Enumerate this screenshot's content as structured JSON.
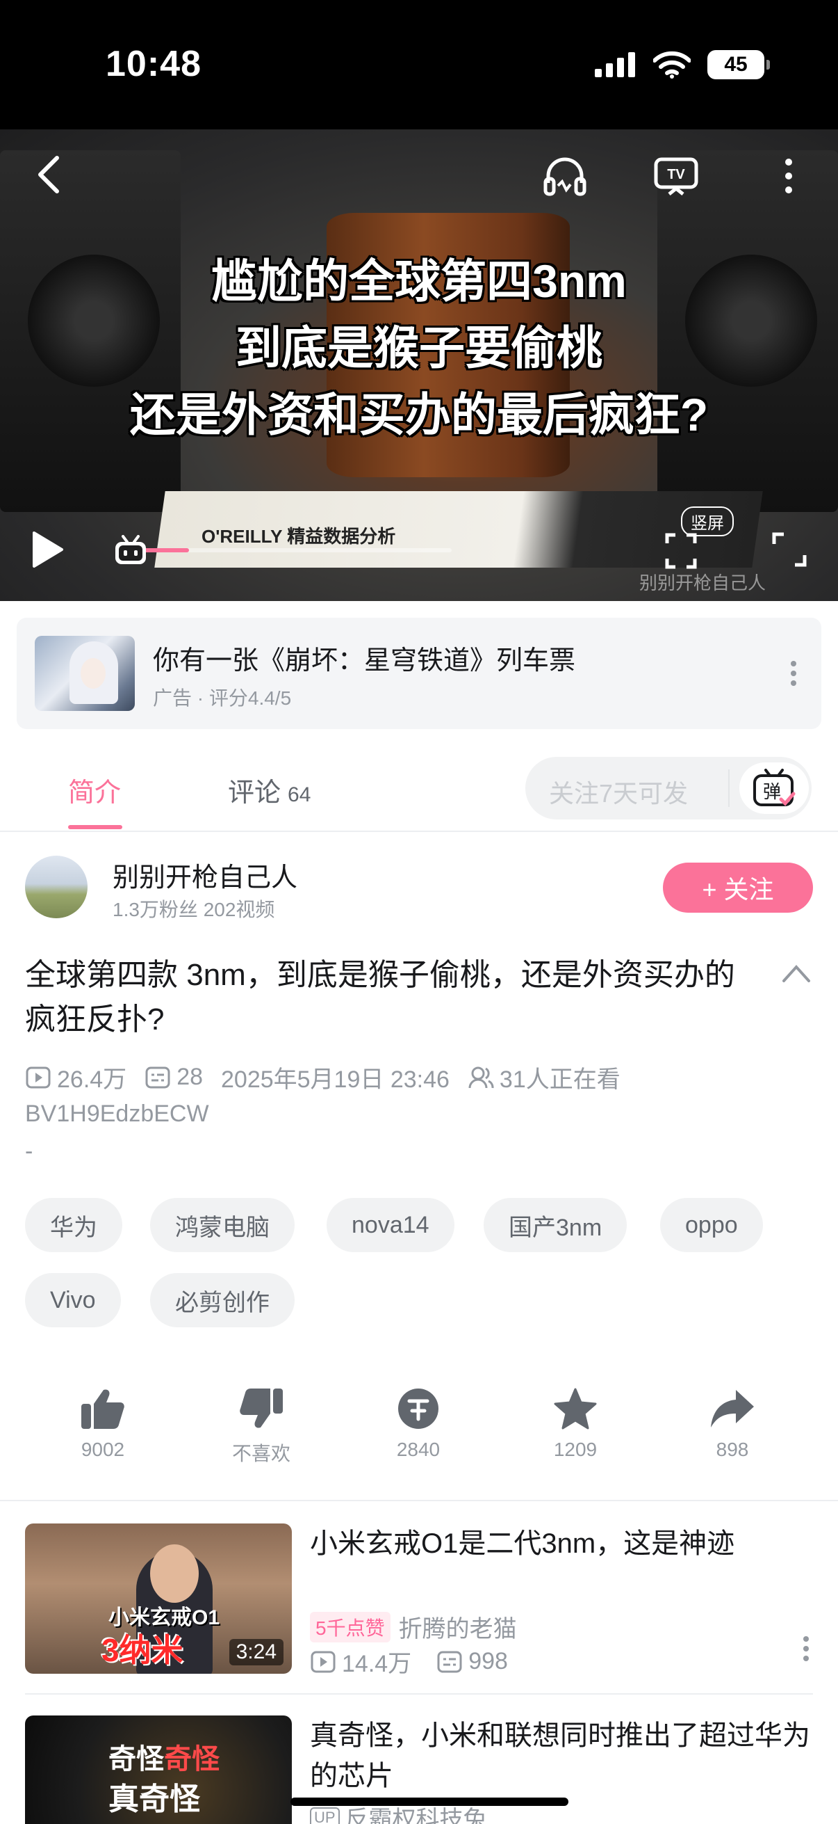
{
  "status_bar": {
    "time": "10:48",
    "battery": "45"
  },
  "video": {
    "caption_lines": [
      "尴尬的全球第四3nm",
      "到底是猴子要偷桃",
      "还是外资和买办的最后疯狂?"
    ],
    "progress": 0.16,
    "portrait_label": "竖屏",
    "book_label": "O'REILLY 精益数据分析",
    "watermark": "别别开枪自己人"
  },
  "ad": {
    "title": "你有一张《崩坏：星穹铁道》列车票",
    "meta": "广告 · 评分4.4/5"
  },
  "tabs": {
    "intro": "简介",
    "comments": "评论",
    "comments_count": "64",
    "danmaku_placeholder": "关注7天可发",
    "danmaku_icon_label": "弹"
  },
  "uploader": {
    "name": "别别开枪自己人",
    "stats": "1.3万粉丝  202视频",
    "follow_label": "+ 关注"
  },
  "video_info": {
    "title": "全球第四款 3nm，到底是猴子偷桃，还是外资买办的疯狂反扑?",
    "views": "26.4万",
    "danmaku_count": "28",
    "date": "2025年5月19日 23:46",
    "watching": "31人正在看",
    "bvid": "BV1H9EdzbECW",
    "description": "-"
  },
  "tags": [
    "华为",
    "鸿蒙电脑",
    "nova14",
    "国产3nm",
    "oppo",
    "Vivo",
    "必剪创作"
  ],
  "actions": {
    "like": "9002",
    "dislike": "不喜欢",
    "coin": "2840",
    "favorite": "1209",
    "share": "898"
  },
  "recommendations": [
    {
      "title": "小米玄戒O1是二代3nm，这是神迹",
      "badge": "5千点赞",
      "uploader": "折腾的老猫",
      "views": "14.4万",
      "danmaku": "998",
      "duration": "3:24",
      "thumb_caption_1": "小米玄戒O1",
      "thumb_caption_2": "3纳米"
    },
    {
      "title": "真奇怪，小米和联想同时推出了超过华为的芯片",
      "uploader_tag": "UP",
      "uploader": "反霸权科技兔",
      "thumb_caption_1a": "奇怪",
      "thumb_caption_1b": "奇怪",
      "thumb_caption_2": "真奇怪"
    }
  ],
  "colors": {
    "accent": "#fb7299",
    "muted": "#9499a0",
    "text": "#18191c"
  }
}
